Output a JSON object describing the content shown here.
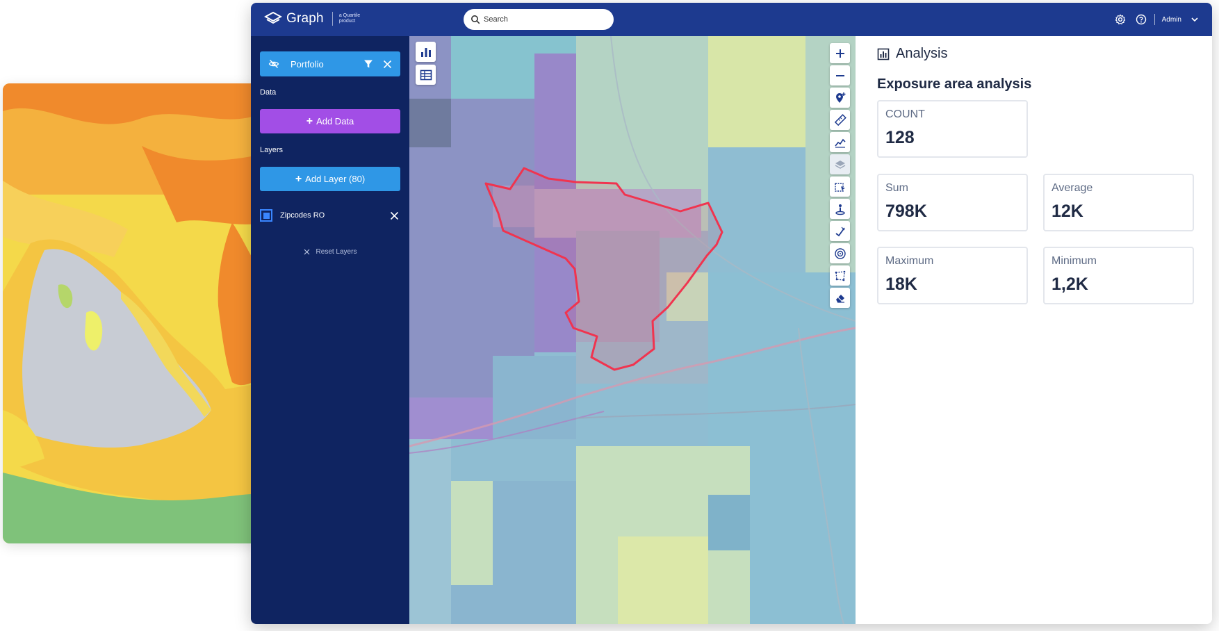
{
  "header": {
    "app_name": "Graph",
    "tagline": "a Quartile product",
    "search_placeholder": "Search",
    "user_name": "Admin"
  },
  "sidebar": {
    "portfolio_label": "Portfolio",
    "data_heading": "Data",
    "add_data_label": "Add Data",
    "layers_heading": "Layers",
    "add_layer_label": "Add Layer (80)",
    "layers": [
      {
        "label": "Zipcodes RO",
        "checked": true
      }
    ],
    "reset_label": "Reset Layers"
  },
  "map": {
    "left_tools": [
      "bar-chart-icon",
      "table-icon"
    ],
    "right_tools": [
      "zoom-in-icon",
      "zoom-out-icon",
      "pin-add-icon",
      "ruler-icon",
      "line-chart-icon",
      "layers-icon",
      "select-area-icon",
      "person-pin-icon",
      "check-edit-icon",
      "target-icon",
      "polygon-icon",
      "eraser-icon"
    ]
  },
  "analysis": {
    "title": "Analysis",
    "subtitle": "Exposure area analysis",
    "stats": [
      {
        "label": "COUNT",
        "value": "128"
      },
      {
        "label": "Sum",
        "value": "798K"
      },
      {
        "label": "Average",
        "value": "12K"
      },
      {
        "label": "Maximum",
        "value": "18K"
      },
      {
        "label": "Minimum",
        "value": "1,2K"
      }
    ]
  },
  "colors": {
    "topbar": "#1d3a8f",
    "sidebar": "#0f2461",
    "primary_blue": "#2f97e6",
    "purple": "#a24ee6",
    "polygon_outline": "#f0344f"
  }
}
